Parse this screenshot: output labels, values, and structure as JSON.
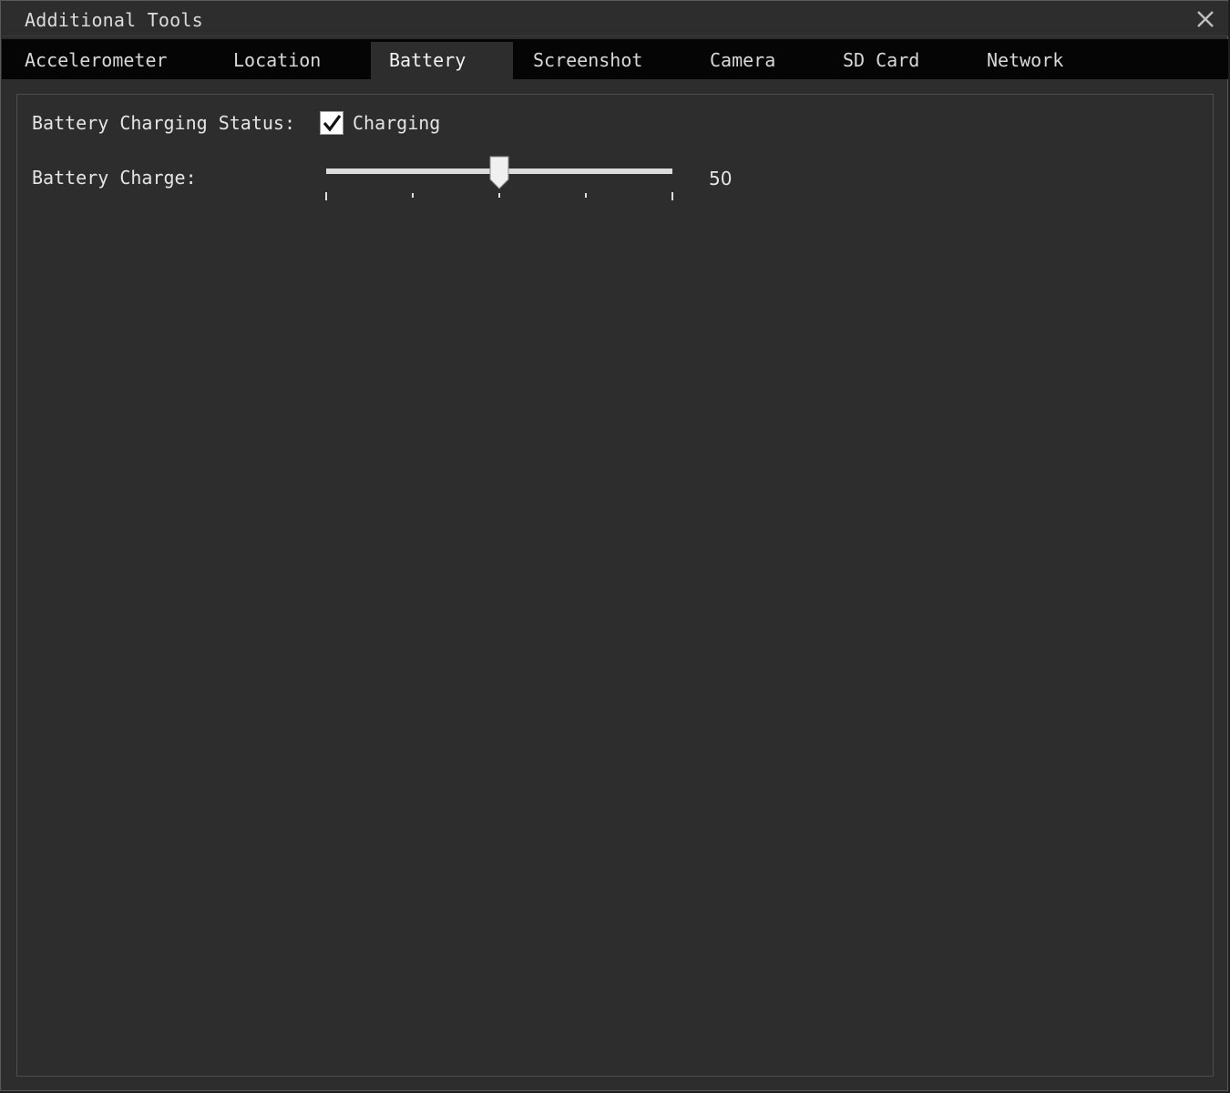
{
  "window": {
    "title": "Additional Tools",
    "close_icon": "close-icon"
  },
  "tabs": [
    {
      "label": "Accelerometer",
      "active": false
    },
    {
      "label": "Location",
      "active": false
    },
    {
      "label": "Battery",
      "active": true
    },
    {
      "label": "Screenshot",
      "active": false
    },
    {
      "label": "Camera",
      "active": false
    },
    {
      "label": "SD Card",
      "active": false
    },
    {
      "label": "Network",
      "active": false
    }
  ],
  "battery": {
    "charging_status_label": "Battery Charging Status:",
    "charging_checked": true,
    "charging_option_label": "Charging",
    "charge_label": "Battery Charge:",
    "charge_value": 50,
    "charge_display": "50",
    "charge_min": 0,
    "charge_max": 100
  },
  "colors": {
    "background": "#2d2d2d",
    "tabbar": "#050505",
    "text": "#e4e4e4"
  }
}
